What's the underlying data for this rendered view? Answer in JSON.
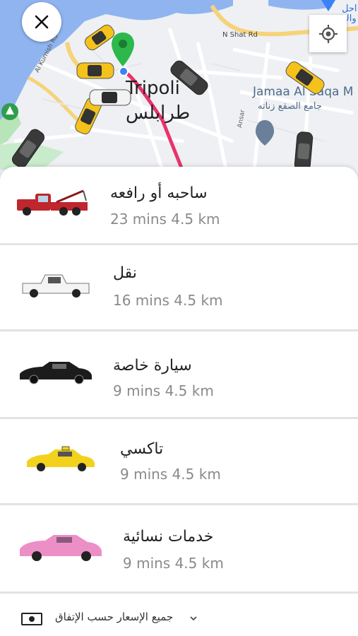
{
  "map": {
    "city_name_en": "Tripoli",
    "city_name_ar": "طرابلس",
    "road_label_1": "Al Kurnish Rd",
    "road_label_2": "N Shat Rd",
    "mosque_label_en": "Jamaa Al Saqa M",
    "mosque_label_ar": "جامع الصقع زناته",
    "road_label_3": "Ansar",
    "corner_label_ar": "احل\nواك",
    "route_color": "#e8336b",
    "pin_color": "#2eb84b",
    "water_color": "#8fb4f0"
  },
  "controls": {
    "close_icon": "close-icon",
    "locate_icon": "crosshair-icon"
  },
  "ride_options": [
    {
      "name": "ساحبه أو رافعه",
      "eta": "23 mins  4.5 km",
      "vehicle": "tow-truck-icon"
    },
    {
      "name": "نقل",
      "eta": "16 mins  4.5 km",
      "vehicle": "pickup-truck-icon"
    },
    {
      "name": "سيارة خاصة",
      "eta": "9 mins 4.5 km",
      "vehicle": "black-sedan-icon"
    },
    {
      "name": "تاكسي",
      "eta": "9 mins 4.5 km",
      "vehicle": "yellow-taxi-icon"
    },
    {
      "name": "خدمات نسائية",
      "eta": "9 mins 4.5 km",
      "vehicle": "pink-sedan-icon"
    }
  ],
  "footer": {
    "pricing_note": "جميع الإسعار حسب الإتفاق",
    "money_icon": "cash-icon",
    "chevron_icon": "chevron-down-icon"
  }
}
